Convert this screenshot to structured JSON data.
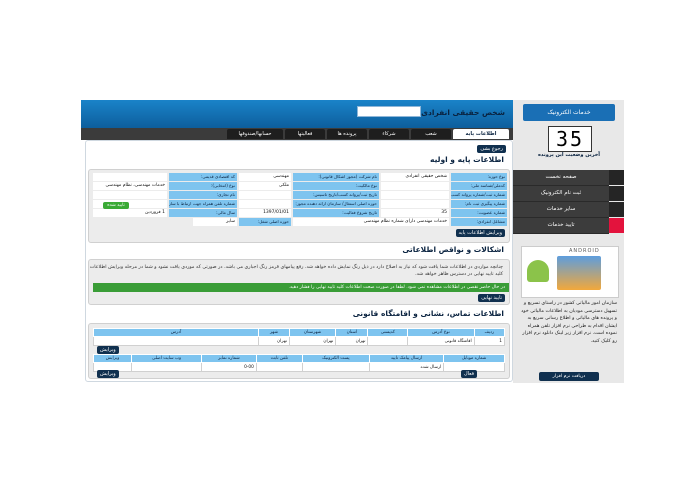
{
  "header": {
    "person_type": "شخص حقیقی انفرادی",
    "person_input_value": ""
  },
  "tabs": [
    {
      "label": "اطلاعات پایه"
    },
    {
      "label": "شعب"
    },
    {
      "label": "شرکاء"
    },
    {
      "label": "پرونده ها"
    },
    {
      "label": "فعالیتها"
    },
    {
      "label": "حسابها/صندوقها"
    }
  ],
  "panel": {
    "back_button": "رجوع بشی",
    "base_info": {
      "title": "اطلاعات پایه و اولیه",
      "rows": [
        {
          "c1l": "نوع حوزه:",
          "c1v": "شخص حقیقی انفرادی",
          "c2l": "نام شرکت (مجوز اشکال قانونی):",
          "c2v": "مهندسی",
          "c3l": "کد اقتصادی قدیمی:",
          "c3v": ""
        },
        {
          "c1l": "کدملی/شناسه ملی:",
          "c1v": "",
          "c2l": "نوع مالکیت:",
          "c2v": "ملکی",
          "c3l": "نوع (انتخابی):",
          "c3v": "خدمات مهندسی، نظام مهندسی"
        },
        {
          "c1l": "شماره ثبت/شماره پروانه کسب:",
          "c1v": "",
          "c2l": "تاریخ ثبت/پروانه کسب/تاریخ تاسیس:",
          "c2v": "",
          "c3l": "نام تجاری:",
          "c3v": ""
        },
        {
          "c1l": "شماره پیگیری ثبت نام:",
          "c1v": "",
          "c2l": "حوزه اصلی استغال/ سازمان ارائه دهنده مجوز:",
          "c2v": "",
          "c3l": "شماره تلفن همراه جهت ارتباط با سازمان:",
          "c3v": ""
        },
        {
          "c1l": "شماره عضویت:",
          "c1v": "35",
          "c2l": "تاریخ شروع فعالیت:",
          "c2v": "1397/01/01",
          "c3l": "سال مالی:",
          "c3v": "1 فروردین"
        },
        {
          "c1l": "مشاغل انفرادی:",
          "c1v": "خدمات مهندسی دارای شماره نظام مهندسی",
          "c2l": "حوزه اصلی شغل:",
          "c2v": "سایر",
          "c3l": "",
          "c3v": ""
        }
      ],
      "verify_button": "تایید شده",
      "edit_button": "ویرایش اطلاعات پایه"
    },
    "issues": {
      "title": "اشکالات و نواقص اطلاعاتی",
      "note": "چنانچه مواردی در اطلاعات شما یافت شود که نیاز به اصلاح دارد در ذیل رنگ نمایش داده خواهد شد. رفع پیامهای قرمز رنگ اجباری می باشد. در صورتی که موردی یافت نشود و شما در مرحله ویرایش اطلاعات کلید تایید نهایی در دسترس ظاهر خواهد شد.",
      "alert": "در حال حاضر نقصی در اطلاعات مشاهده نمی شود. لطفا در صورت صحت اطلاعات کلید تایید نهایی را فشار دهید.",
      "final_button": "تایید نهایی"
    },
    "contact": {
      "title": "اطلاعات تماس، نشانی و اقامتگاه قانونی",
      "address_headers": [
        "ردیف",
        "نوع آدرس",
        "کدپستی",
        "استان",
        "شهرستان",
        "شهر",
        "آدرس"
      ],
      "address_row": [
        "1",
        "اقامتگاه قانونی",
        "",
        "تهران",
        "تهران",
        "تهران",
        ""
      ],
      "edit_label": "ویرایش",
      "contact_headers": [
        "شماره موبایل",
        "ارسال پیامک تایید",
        "پست الکترونیک",
        "تلفن ثابت",
        "شماره نمابر",
        "وب سایت اصلی",
        "ویرایش"
      ],
      "contact_row": [
        "",
        "ارسال شده",
        "",
        "",
        "0-00",
        "",
        ""
      ],
      "status_badge": "فعال"
    }
  },
  "sidebar": {
    "logo_text": "خدمات الکترونیک",
    "counter": "35",
    "counter_label": "آخرین وضعیت این پرونده",
    "nav": [
      {
        "label": "صفحه نخست",
        "mark": "dark"
      },
      {
        "label": "ثبت نام الکترونیک",
        "mark": "dark"
      },
      {
        "label": "سایر خدمات",
        "mark": "dark"
      },
      {
        "label": "تایید خدمات",
        "mark": "red"
      }
    ],
    "android_label": "ANDROID",
    "description": "سازمان امور مالیاتی کشور در راستای تسریع و تسهیل دسترسی مودیان به اطلاعات مالیاتی خود و پرونده های مالیاتی و اطلاع رسانی سریع به ایشان اقدام به طراحی نرم افزار تلفن همراه نموده است. نرم افزار زیر لینک دانلود نرم افزار رو کلیک کنید.",
    "download_button": "دریافت نرم افزار"
  },
  "colors": {
    "header_blue": "#1a83c9",
    "label_blue": "#7ec4ef",
    "alert_green": "#3a9d37",
    "sidebar_red": "#e3133d",
    "dark_nav": "#3c3c3c"
  }
}
